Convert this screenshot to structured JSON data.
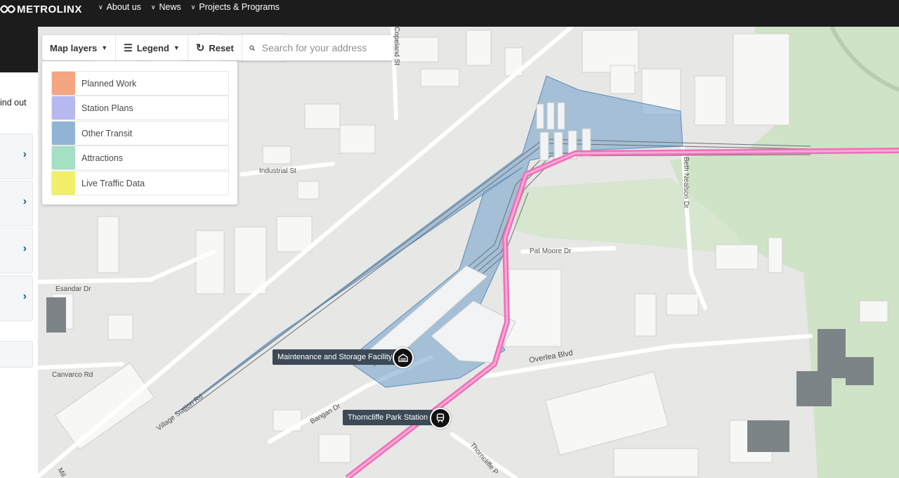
{
  "header": {
    "logo_text": "METROLINX",
    "nav": [
      {
        "label": "About us"
      },
      {
        "label": "News"
      },
      {
        "label": "Projects & Programs"
      }
    ]
  },
  "sidebar": {
    "partial_text": "ind out",
    "card_count": 4
  },
  "toolbar": {
    "map_layers_label": "Map layers",
    "legend_label": "Legend",
    "reset_label": "Reset",
    "search_placeholder": "Search for your address"
  },
  "layers": [
    {
      "label": "Planned Work",
      "color": "#f4a582"
    },
    {
      "label": "Station Plans",
      "color": "#b8b8f0"
    },
    {
      "label": "Other Transit",
      "color": "#92b4d4"
    },
    {
      "label": "Attractions",
      "color": "#a5dfc5"
    },
    {
      "label": "Live Traffic Data",
      "color": "#f2f06a"
    }
  ],
  "map": {
    "streets": {
      "copeland": "Copeland St",
      "industrial": "Industrial St",
      "beth_nealson": "Beth Nealson Dr",
      "pat_moore": "Pat Moore Dr",
      "esandar": "Esandar Dr",
      "canvarco": "Canvarco Rd",
      "village_station": "Village Station Rd",
      "bangan": "Bangan Dr",
      "overlea": "Overlea Blvd",
      "thorncliffe": "Thorncliffe P",
      "mill": "Mil"
    },
    "markers": {
      "maintenance": "Maintenance and Storage Facility",
      "station": "Thorncliffe Park Station"
    },
    "colors": {
      "line": "#ef6fb8",
      "facility": "#6d9ecb",
      "greenery": "#cfe3c7"
    }
  }
}
